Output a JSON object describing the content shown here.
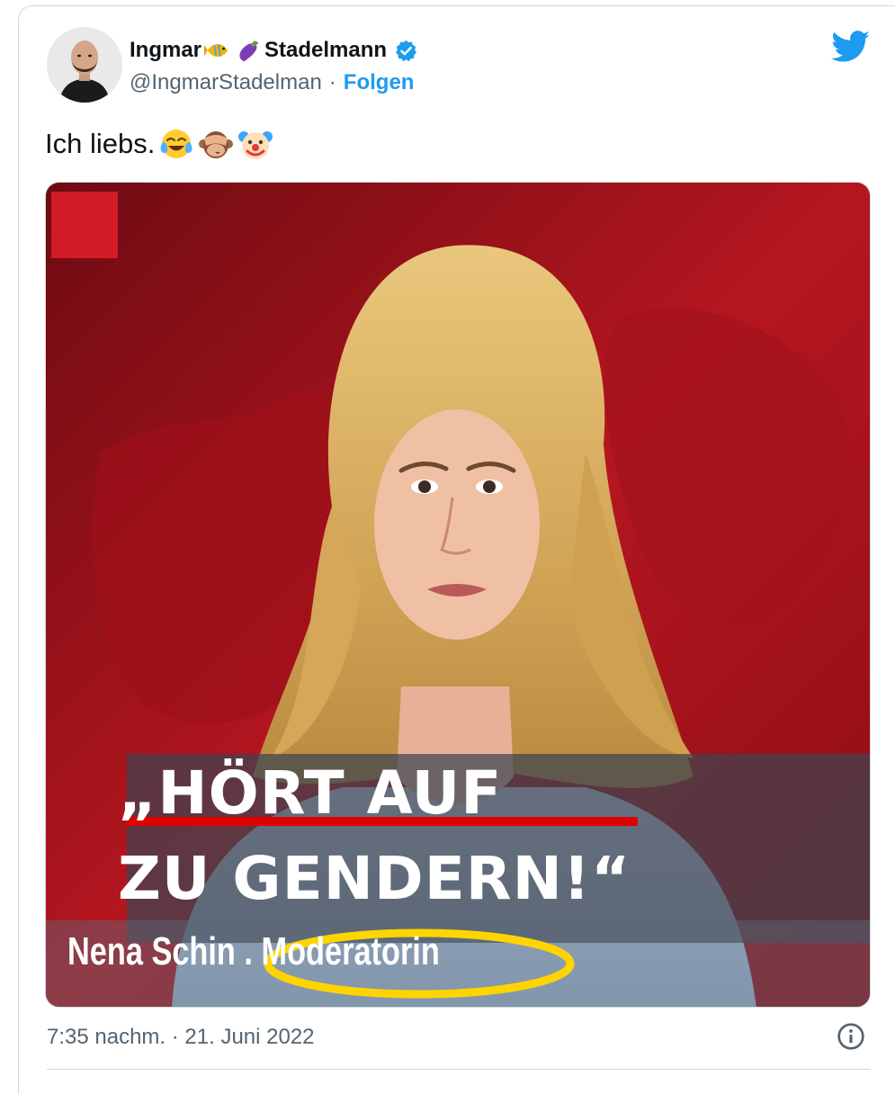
{
  "author": {
    "name_first": "Ingmar",
    "name_last": "Stadelmann",
    "name_emojis": [
      "fish-icon",
      "eggplant-icon"
    ],
    "handle": "@IngmarStadelman",
    "separator": "·",
    "follow_label": "Folgen",
    "verified": true
  },
  "tweet": {
    "text": "Ich liebs.",
    "text_emojis": [
      "tears-of-joy-emoji",
      "see-no-evil-monkey-emoji",
      "clown-face-emoji"
    ],
    "timestamp": "7:35 nachm. · 21. Juni 2022"
  },
  "media": {
    "headline_line1": "„HÖRT AUF",
    "headline_line2": "ZU GENDERN!“",
    "caption": "Nena Schin . Moderatorin",
    "accent_color": "#e00000",
    "highlight_color": "#ffd400"
  },
  "colors": {
    "link": "#1d9bf0",
    "muted": "#536471",
    "border": "#cfd9de"
  }
}
